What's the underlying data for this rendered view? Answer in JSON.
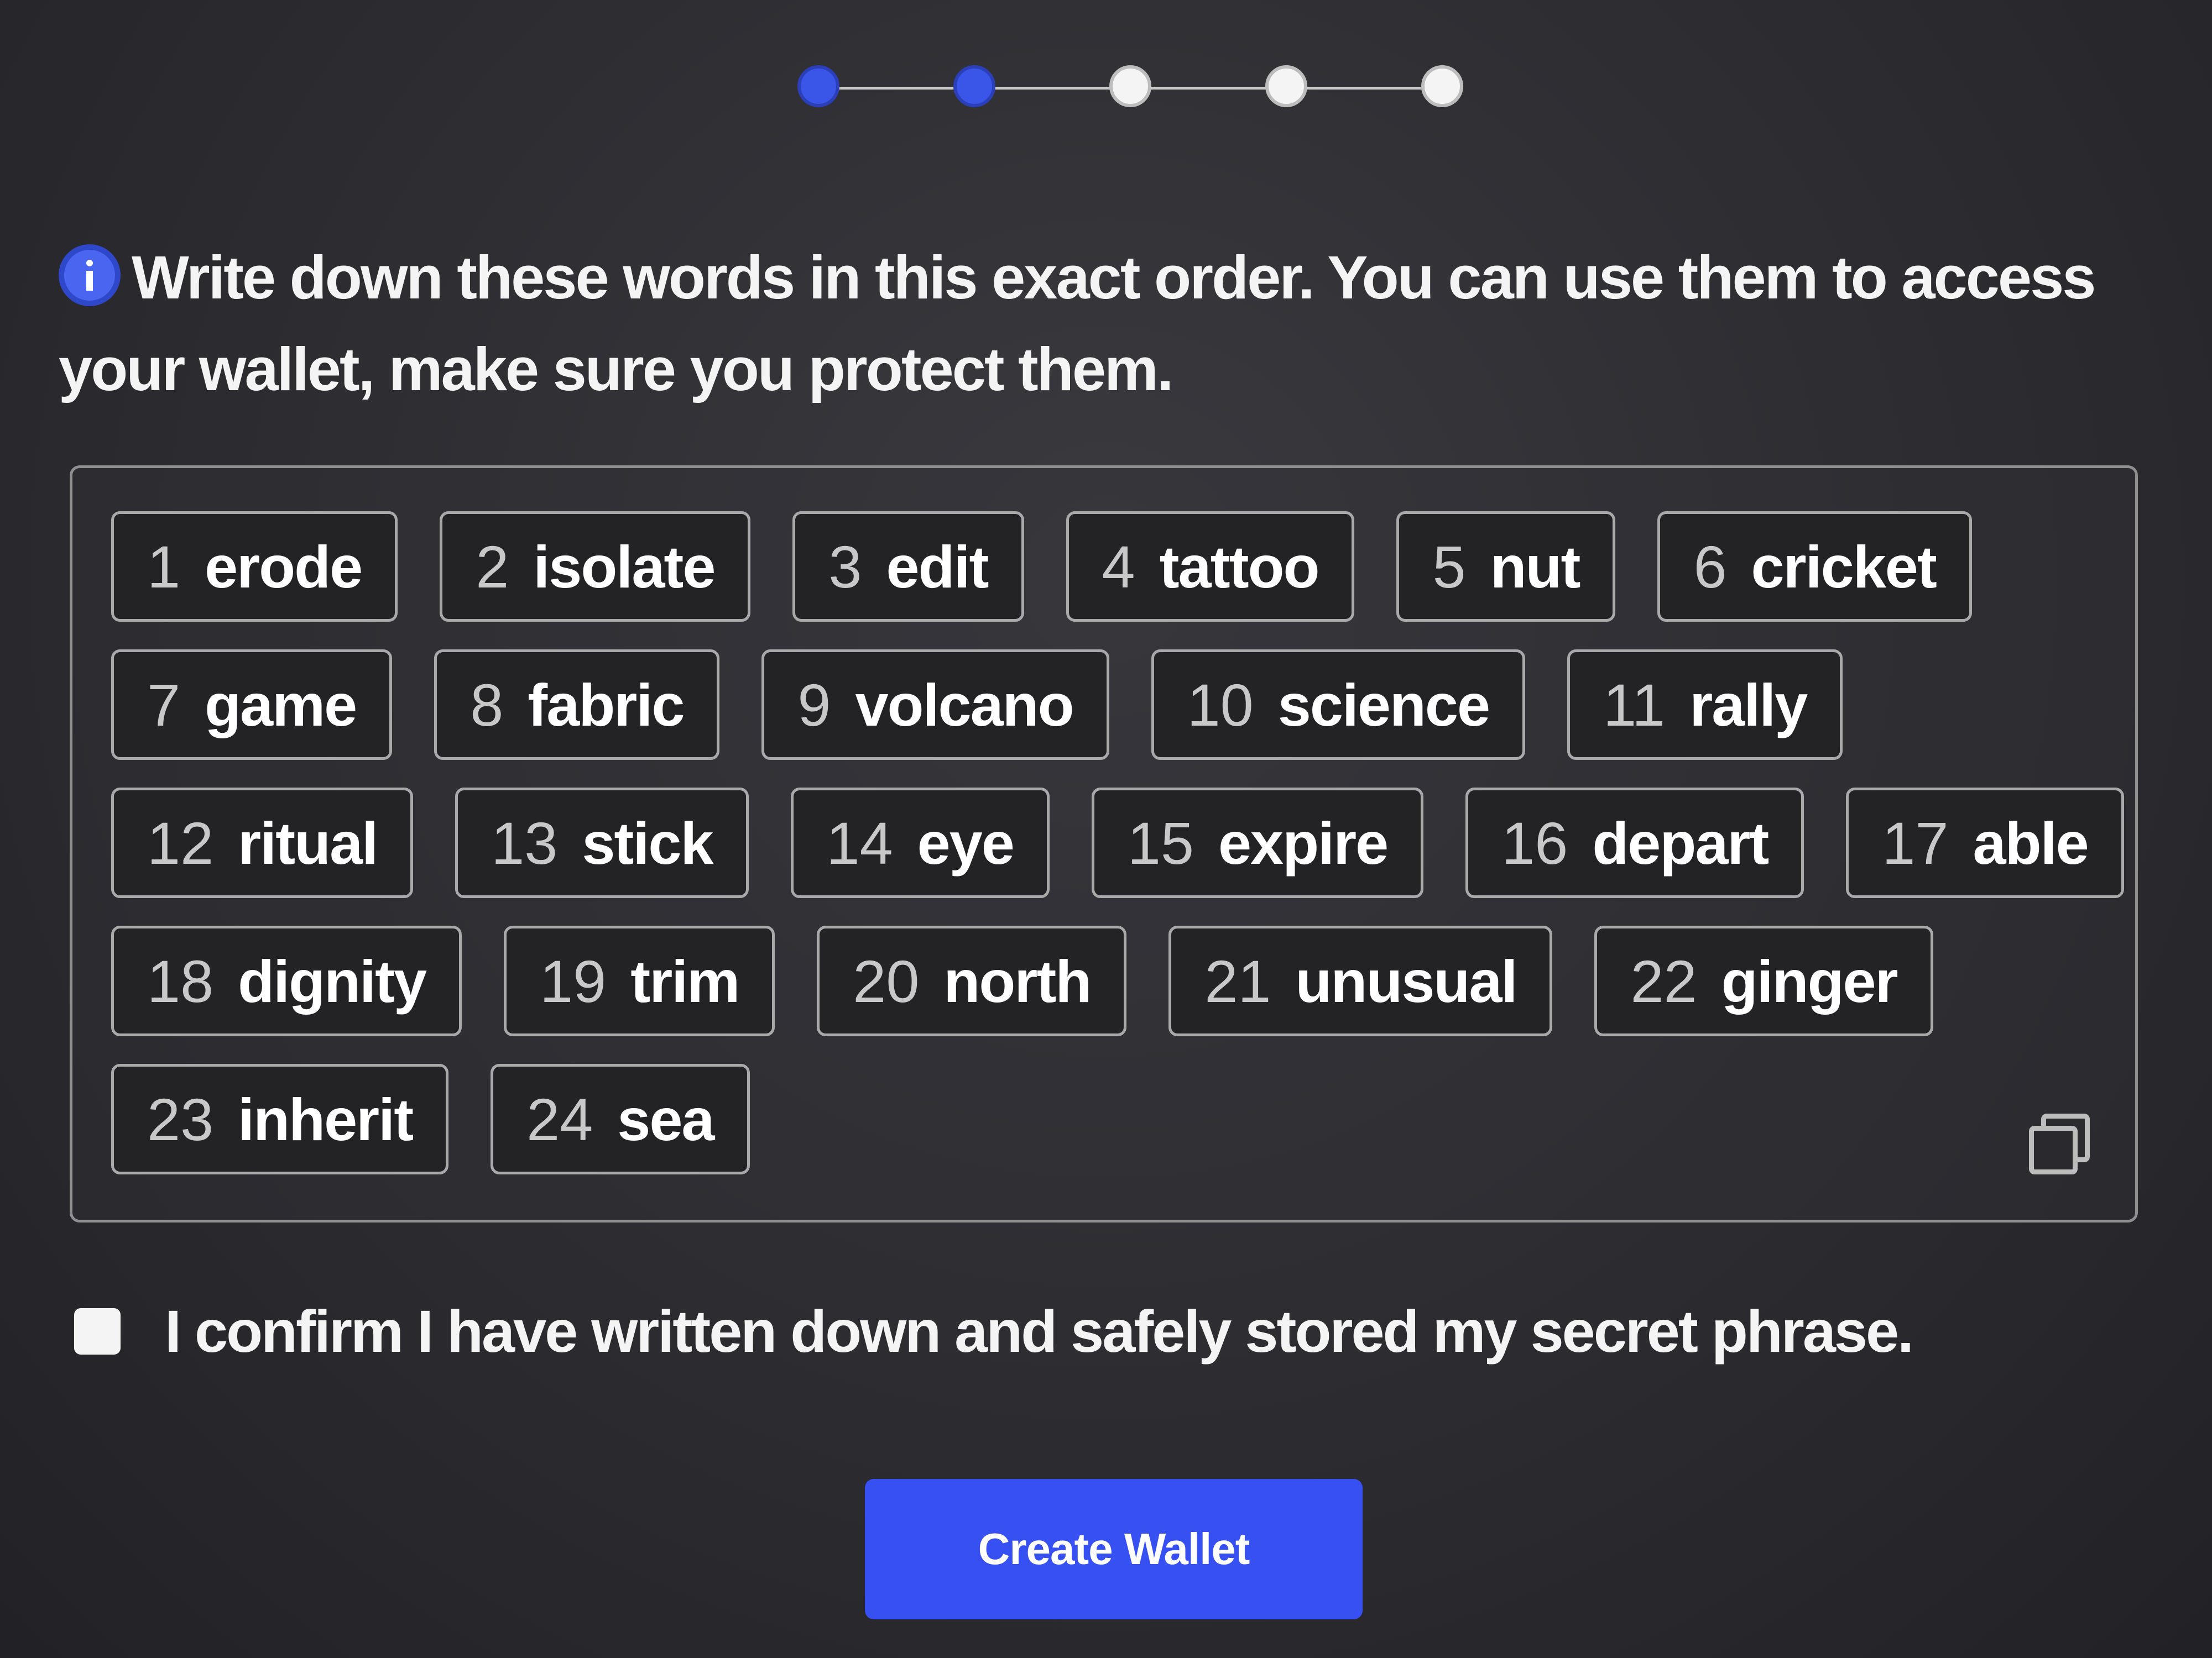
{
  "stepper": {
    "total_steps": 5,
    "completed_steps": 2,
    "colors": {
      "done": "#3a56e8",
      "todo": "#f4f4f4"
    }
  },
  "instruction": {
    "icon": "info-icon",
    "text": "Write down these words in this exact order. You can use them to access your wallet, make sure you protect them."
  },
  "phrase": {
    "words": [
      {
        "num": "1",
        "word": "erode"
      },
      {
        "num": "2",
        "word": "isolate"
      },
      {
        "num": "3",
        "word": "edit"
      },
      {
        "num": "4",
        "word": "tattoo"
      },
      {
        "num": "5",
        "word": "nut"
      },
      {
        "num": "6",
        "word": "cricket"
      },
      {
        "num": "7",
        "word": "game"
      },
      {
        "num": "8",
        "word": "fabric"
      },
      {
        "num": "9",
        "word": "volcano"
      },
      {
        "num": "10",
        "word": "science"
      },
      {
        "num": "11",
        "word": "rally"
      },
      {
        "num": "12",
        "word": "ritual"
      },
      {
        "num": "13",
        "word": "stick"
      },
      {
        "num": "14",
        "word": "eye"
      },
      {
        "num": "15",
        "word": "expire"
      },
      {
        "num": "16",
        "word": "depart"
      },
      {
        "num": "17",
        "word": "able"
      },
      {
        "num": "18",
        "word": "dignity"
      },
      {
        "num": "19",
        "word": "trim"
      },
      {
        "num": "20",
        "word": "north"
      },
      {
        "num": "21",
        "word": "unusual"
      },
      {
        "num": "22",
        "word": "ginger"
      },
      {
        "num": "23",
        "word": "inherit"
      },
      {
        "num": "24",
        "word": "sea"
      }
    ],
    "copy_icon": "copy-icon"
  },
  "confirm": {
    "label": "I confirm I have written down and safely stored my secret phrase.",
    "checked": false
  },
  "create_button": {
    "label": "Create Wallet",
    "color": "#3650f2"
  }
}
